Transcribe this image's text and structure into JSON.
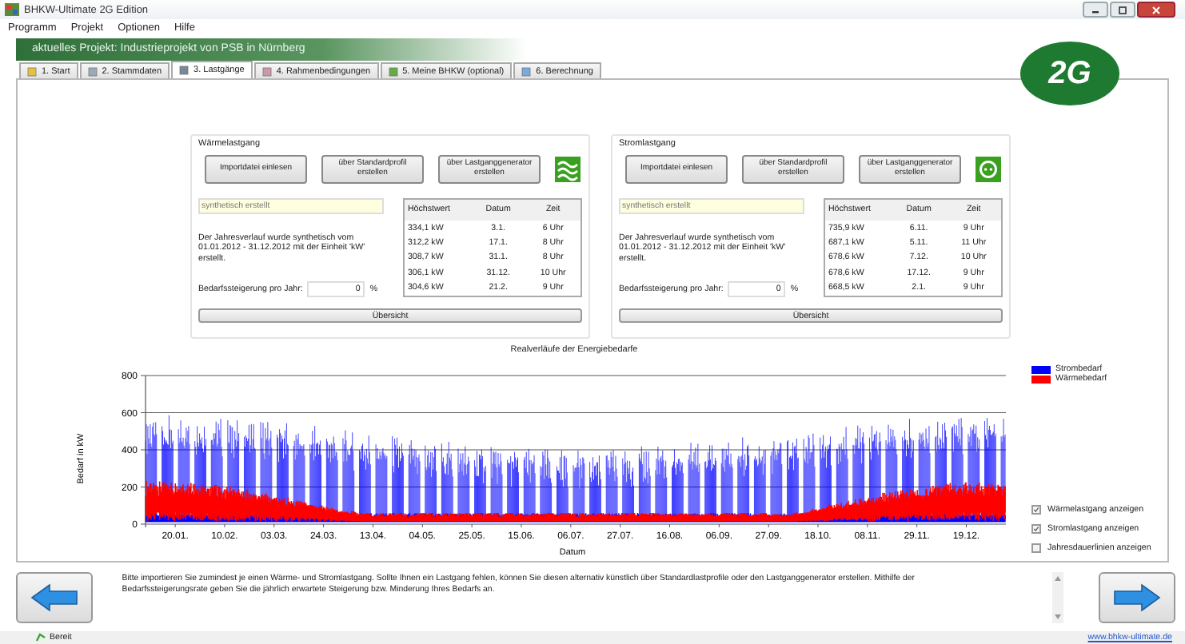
{
  "window": {
    "title": "BHKW-Ultimate 2G Edition"
  },
  "menu": [
    "Programm",
    "Projekt",
    "Optionen",
    "Hilfe"
  ],
  "project_banner": "aktuelles Projekt: Industrieprojekt von PSB in Nürnberg",
  "logo": "2G",
  "tabs": [
    {
      "label": "1. Start",
      "selected": false
    },
    {
      "label": "2. Stammdaten",
      "selected": false
    },
    {
      "label": "3. Lastgänge",
      "selected": true
    },
    {
      "label": "4. Rahmenbedingungen",
      "selected": false
    },
    {
      "label": "5. Meine BHKW (optional)",
      "selected": false
    },
    {
      "label": "6. Berechnung",
      "selected": false
    }
  ],
  "load_groups": [
    {
      "kind": "heat",
      "title": "Wärmelastgang",
      "buttons": [
        "Importdatei einlesen",
        "über Standardprofil erstellen",
        "über Lastganggenerator erstellen"
      ],
      "source": "synthetisch erstellt",
      "description": "Der Jahresverlauf wurde synthetisch vom 01.01.2012 - 31.12.2012 mit der Einheit 'kW' erstellt.",
      "growth_label": "Bedarfssteigerung pro Jahr:",
      "growth_value": "0",
      "growth_unit": "%",
      "columns": [
        "Höchstwert",
        "Datum",
        "Zeit"
      ],
      "rows": [
        [
          "334,1 kW",
          "3.1.",
          "6 Uhr"
        ],
        [
          "312,2 kW",
          "17.1.",
          "8 Uhr"
        ],
        [
          "308,7 kW",
          "31.1.",
          "8 Uhr"
        ],
        [
          "306,1 kW",
          "31.12.",
          "10 Uhr"
        ],
        [
          "304,6 kW",
          "21.2.",
          "9 Uhr"
        ]
      ],
      "overview_button": "Übersicht"
    },
    {
      "kind": "power",
      "title": "Stromlastgang",
      "buttons": [
        "Importdatei einlesen",
        "über Standardprofil erstellen",
        "über Lastganggenerator erstellen"
      ],
      "source": "synthetisch erstellt",
      "description": "Der Jahresverlauf wurde synthetisch vom 01.01.2012 - 31.12.2012 mit der Einheit 'kW' erstellt.",
      "growth_label": "Bedarfssteigerung pro Jahr:",
      "growth_value": "0",
      "growth_unit": "%",
      "columns": [
        "Höchstwert",
        "Datum",
        "Zeit"
      ],
      "rows": [
        [
          "735,9 kW",
          "6.11.",
          "9 Uhr"
        ],
        [
          "687,1 kW",
          "5.11.",
          "11 Uhr"
        ],
        [
          "678,6 kW",
          "7.12.",
          "10 Uhr"
        ],
        [
          "678,6 kW",
          "17.12.",
          "9 Uhr"
        ],
        [
          "668,5 kW",
          "2.1.",
          "9 Uhr"
        ]
      ],
      "overview_button": "Übersicht"
    }
  ],
  "chart": {
    "title": "Realverläufe der Energiebedarfe",
    "ylabel": "Bedarf in kW",
    "xlabel": "Datum",
    "yticks": [
      "800",
      "600",
      "400",
      "200",
      "0"
    ],
    "xticks": [
      "20.01.",
      "10.02.",
      "03.03.",
      "24.03.",
      "13.04.",
      "04.05.",
      "25.05.",
      "15.06.",
      "06.07.",
      "27.07.",
      "16.08.",
      "06.09.",
      "27.09.",
      "18.10.",
      "08.11.",
      "29.11.",
      "19.12."
    ],
    "legend": [
      {
        "label": "Strombedarf",
        "color": "#0000ff"
      },
      {
        "label": "Wärmebedarf",
        "color": "#ff0000"
      }
    ]
  },
  "display_options": [
    {
      "label": "Wärmelastgang anzeigen",
      "checked": true
    },
    {
      "label": "Stromlastgang anzeigen",
      "checked": true
    },
    {
      "label": "Jahresdauerlinien anzeigen",
      "checked": false
    }
  ],
  "hint": "Bitte importieren Sie zumindest je einen Wärme- und Stromlastgang. Sollte Ihnen ein Lastgang fehlen, können Sie diesen alternativ künstlich über Standardlastprofile oder den Lastganggenerator erstellen. Mithilfe der Bedarfssteigerungsrate geben Sie die jährlich erwartete Steigerung bzw. Minderung Ihres Bedarfs an.",
  "status_bar": {
    "text": "Bereit",
    "link": "www.bhkw-ultimate.de"
  }
}
